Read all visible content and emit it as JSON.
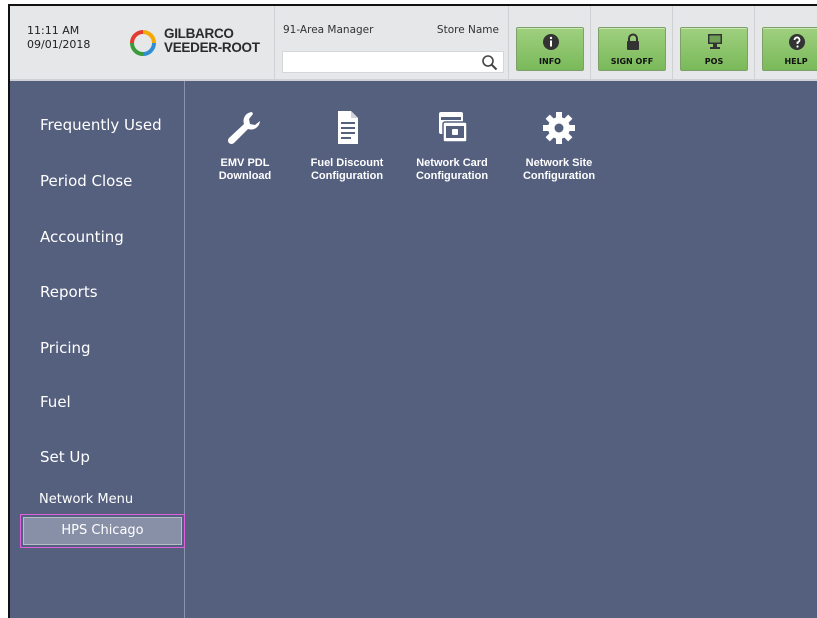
{
  "header": {
    "time": "11:11 AM",
    "date": "09/01/2018",
    "logo_line1": "GILBARCO",
    "logo_line2": "VEEDER-ROOT",
    "user": "91-Area Manager",
    "store": "Store Name",
    "search_value": "",
    "buttons": [
      {
        "label": "INFO",
        "icon": "info-icon"
      },
      {
        "label": "SIGN OFF",
        "icon": "lock-icon"
      },
      {
        "label": "POS",
        "icon": "monitor-icon"
      },
      {
        "label": "HELP",
        "icon": "help-icon"
      }
    ]
  },
  "sidebar": {
    "items": [
      {
        "label": "Frequently Used"
      },
      {
        "label": "Period Close"
      },
      {
        "label": "Accounting"
      },
      {
        "label": "Reports"
      },
      {
        "label": "Pricing"
      },
      {
        "label": "Fuel"
      },
      {
        "label": "Set Up"
      }
    ],
    "sub_items": [
      {
        "label": "Network Menu"
      },
      {
        "label": "HPS Chicago",
        "selected": true
      }
    ]
  },
  "main": {
    "tiles": [
      {
        "label_line1": "EMV PDL",
        "label_line2": "Download",
        "icon": "wrench-icon"
      },
      {
        "label_line1": "Fuel Discount",
        "label_line2": "Configuration",
        "icon": "document-icon"
      },
      {
        "label_line1": "Network Card",
        "label_line2": "Configuration",
        "icon": "card-window-icon"
      },
      {
        "label_line1": "Network Site",
        "label_line2": "Configuration",
        "icon": "gear-icon"
      }
    ]
  },
  "colors": {
    "content_bg": "#55607f",
    "header_bg": "#e6e7e9",
    "button_green": "#8cc56b",
    "selected_border": "#e060e0"
  }
}
